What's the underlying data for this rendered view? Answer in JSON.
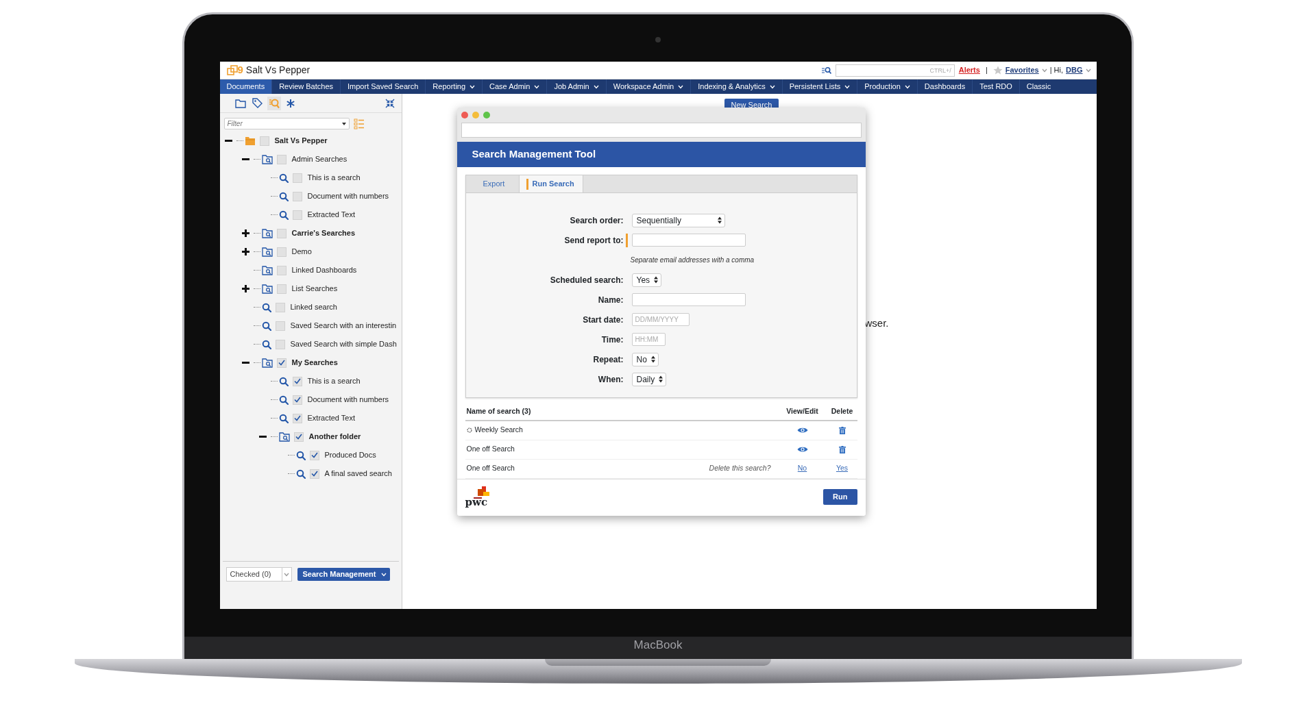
{
  "laptop": {
    "brand": "MacBook"
  },
  "app": {
    "logo_digit": "9",
    "title": "Salt Vs Pepper",
    "search": {
      "placeholder": "CTRL+/"
    },
    "alerts": "Alerts",
    "separator": "|",
    "favorites": "Favorites",
    "greeting": "| Hi,",
    "user": "DBG"
  },
  "nav": [
    {
      "label": "Documents",
      "selected": true,
      "dropdown": false
    },
    {
      "label": "Review Batches",
      "selected": false,
      "dropdown": false
    },
    {
      "label": "Import Saved Search",
      "selected": false,
      "dropdown": false
    },
    {
      "label": "Reporting",
      "selected": false,
      "dropdown": true
    },
    {
      "label": "Case Admin",
      "selected": false,
      "dropdown": true
    },
    {
      "label": "Job Admin",
      "selected": false,
      "dropdown": true
    },
    {
      "label": "Workspace Admin",
      "selected": false,
      "dropdown": true
    },
    {
      "label": "Indexing & Analytics",
      "selected": false,
      "dropdown": true
    },
    {
      "label": "Persistent Lists",
      "selected": false,
      "dropdown": true
    },
    {
      "label": "Production",
      "selected": false,
      "dropdown": true
    },
    {
      "label": "Dashboards",
      "selected": false,
      "dropdown": false
    },
    {
      "label": "Test RDO",
      "selected": false,
      "dropdown": false
    },
    {
      "label": "Classic",
      "selected": false,
      "dropdown": false
    }
  ],
  "sidebar": {
    "filter": {
      "placeholder": "Filter"
    },
    "tree": [
      {
        "label": "Salt Vs Pepper",
        "kind": "root",
        "bold": true,
        "expanded": true,
        "checked": false,
        "children": [
          {
            "label": "Admin Searches",
            "kind": "folder",
            "bold": false,
            "expanded": true,
            "checked": false,
            "children": [
              {
                "label": "This is a search",
                "kind": "search",
                "bold": false,
                "checked": false
              },
              {
                "label": "Document with numbers",
                "kind": "search",
                "bold": false,
                "checked": false
              },
              {
                "label": "Extracted Text",
                "kind": "search",
                "bold": false,
                "checked": false
              }
            ]
          },
          {
            "label": "Carrie's Searches",
            "kind": "folder",
            "bold": true,
            "expanded": false,
            "checked": false
          },
          {
            "label": "Demo",
            "kind": "folder",
            "bold": false,
            "expanded": false,
            "checked": false
          },
          {
            "label": "Linked Dashboards",
            "kind": "folder",
            "bold": false,
            "checked": false
          },
          {
            "label": "List Searches",
            "kind": "folder",
            "bold": false,
            "expanded": false,
            "checked": false
          },
          {
            "label": "Linked search",
            "kind": "search",
            "bold": false,
            "checked": false
          },
          {
            "label": "Saved Search with an interestin",
            "kind": "search",
            "bold": false,
            "checked": false
          },
          {
            "label": "Saved Search with simple Dash",
            "kind": "search",
            "bold": false,
            "checked": false
          },
          {
            "label": "My Searches",
            "kind": "folder",
            "bold": true,
            "expanded": true,
            "checked": true,
            "children": [
              {
                "label": "This is a search",
                "kind": "search",
                "bold": false,
                "checked": true
              },
              {
                "label": "Document with numbers",
                "kind": "search",
                "bold": false,
                "checked": true
              },
              {
                "label": "Extracted Text",
                "kind": "search",
                "bold": false,
                "checked": true
              },
              {
                "label": "Another folder",
                "kind": "folder",
                "bold": true,
                "expanded": true,
                "checked": true,
                "children": [
                  {
                    "label": "Produced Docs",
                    "kind": "search",
                    "bold": false,
                    "checked": true
                  },
                  {
                    "label": "A final saved search",
                    "kind": "search",
                    "bold": false,
                    "checked": true
                  }
                ]
              }
            ]
          }
        ]
      }
    ],
    "checked_select": "Checked (0)",
    "action_button": "Search Management"
  },
  "main": {
    "new_search_button": "New Search",
    "background_text": "wser."
  },
  "dialog": {
    "title": "Search Management Tool",
    "tabs": [
      {
        "label": "Export",
        "selected": false
      },
      {
        "label": "Run Search",
        "selected": true
      }
    ],
    "form": [
      {
        "label": "Search order:",
        "kind": "wide-select",
        "value": "Sequentially",
        "flagged": false
      },
      {
        "label": "Send report to:",
        "kind": "text",
        "flagged": true,
        "hint": "Separate email addresses with a comma"
      },
      {
        "label": "Scheduled search:",
        "kind": "select",
        "value": "Yes",
        "flagged": false
      },
      {
        "label": "Name:",
        "kind": "text",
        "flagged": false
      },
      {
        "label": "Start date:",
        "kind": "short",
        "placeholder": "DD/MM/YYYY",
        "flagged": false
      },
      {
        "label": "Time:",
        "kind": "short",
        "placeholder": "HH:MM",
        "flagged": false
      },
      {
        "label": "Repeat:",
        "kind": "select",
        "value": "No",
        "flagged": false
      },
      {
        "label": "When:",
        "kind": "select",
        "value": "Daily",
        "flagged": false
      }
    ],
    "table": {
      "columns": [
        "Name of search (3)",
        "View/Edit",
        "Delete"
      ],
      "rows": [
        {
          "kind": "actions",
          "name": "Weekly Search",
          "spinner": true
        },
        {
          "kind": "actions",
          "name": "One off Search",
          "spinner": false
        },
        {
          "kind": "confirm",
          "name": "One off Search",
          "prompt": "Delete this search?",
          "no": "No",
          "yes": "Yes"
        }
      ]
    },
    "logo_text": "pwc",
    "run_button": "Run"
  }
}
